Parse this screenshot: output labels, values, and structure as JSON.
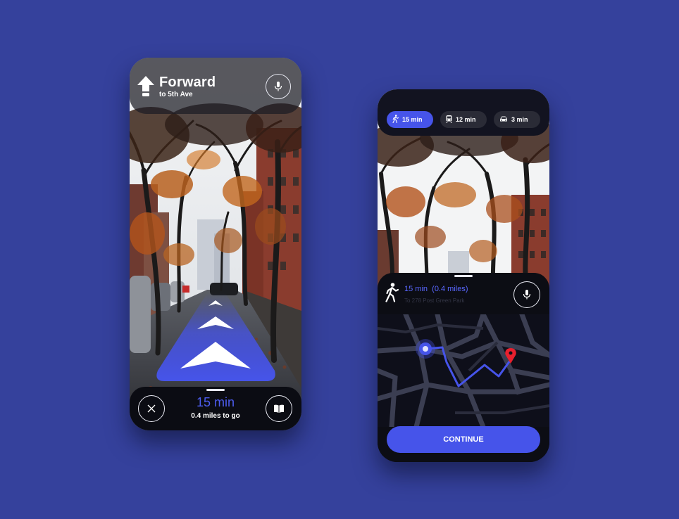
{
  "ar_screen": {
    "direction_title": "Forward",
    "direction_subtitle": "to 5th Ave",
    "eta": "15 min",
    "distance_remaining": "0.4 miles to go",
    "icons": {
      "direction": "arrow-up-icon",
      "voice": "microphone-icon",
      "close": "close-icon",
      "guide": "book-icon"
    }
  },
  "route_screen": {
    "modes": [
      {
        "label": "15 min",
        "icon": "walk-icon",
        "selected": true
      },
      {
        "label": "12 min",
        "icon": "train-icon",
        "selected": false
      },
      {
        "label": "3 min",
        "icon": "car-icon",
        "selected": false
      }
    ],
    "summary_time": "15 min",
    "summary_distance": "(0.4 miles)",
    "destination": "To 278 Post Green Park",
    "continue_label": "CONTINUE",
    "icons": {
      "walk": "walking-person-icon",
      "voice": "microphone-icon",
      "origin": "current-location-icon",
      "pin": "map-pin-icon"
    }
  },
  "colors": {
    "background": "#35419c",
    "accent": "#4654ea",
    "pin": "#e8202e",
    "dark": "#0c0d14"
  }
}
